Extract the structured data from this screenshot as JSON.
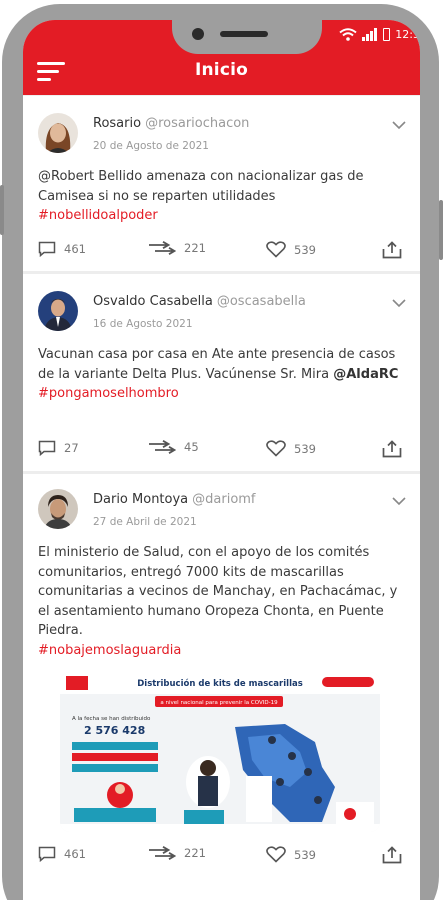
{
  "status_bar": {
    "time": "12:3"
  },
  "header": {
    "title": "Inicio"
  },
  "posts": [
    {
      "name": "Rosario",
      "handle": "@rosariochacon",
      "date": "20 de Agosto de 2021",
      "text_1": "@Robert Bellido amenaza con nacionalizar gas de Camisea si no se reparten utilidades",
      "hashtag": "#nobellidoalpoder",
      "comments": "461",
      "shares": "221",
      "likes": "539"
    },
    {
      "name": "Osvaldo Casabella",
      "handle": "@oscasabella",
      "date": "16 de Agosto 2021",
      "text_1": "Vacunan casa por casa en Ate ante presencia de casos de la variante Delta Plus. Vacúnense Sr. Mira ",
      "mention": "@AldaRC",
      "hashtag": "#pongamoselhombro",
      "comments": "27",
      "shares": "45",
      "likes": "539"
    },
    {
      "name": "Dario Montoya",
      "handle": "@dariomf",
      "date": "27 de Abril de 2021",
      "text_1": "El ministerio de Salud, con el apoyo de los comités comunitarios, entregó 7000 kits de mascarillas comunitarias a vecinos de Manchay, en Pachacámac, y el asentamiento humano Oropeza Chonta, en Puente Piedra.",
      "hashtag": "#nobajemoslaguardia",
      "image": {
        "title": "Distribución de kits de mascarillas",
        "subtitle": "a nivel nacional para prevenir la COVID-19",
        "big_number": "2 576 428"
      },
      "comments": "461",
      "shares": "221",
      "likes": "539"
    }
  ],
  "colors": {
    "accent": "#e31c25",
    "frame": "#9e9e9e"
  }
}
